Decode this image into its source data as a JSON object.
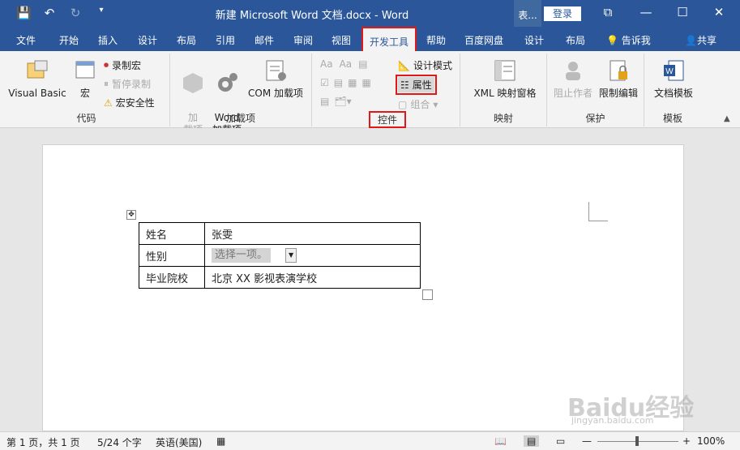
{
  "title_bar": {
    "title": "新建 Microsoft Word 文档.docx  -  Word",
    "mini_tab": "表...",
    "login": "登录"
  },
  "tabs": [
    "文件",
    "开始",
    "插入",
    "设计",
    "布局",
    "引用",
    "邮件",
    "审阅",
    "视图",
    "开发工具",
    "帮助",
    "百度网盘",
    "设计",
    "布局"
  ],
  "tell_me": "告诉我",
  "share": "共享",
  "groups": {
    "code": {
      "label": "代码",
      "visual_basic": "Visual Basic",
      "macro": "宏",
      "record": "录制宏",
      "pause": "暂停录制",
      "security": "宏安全性"
    },
    "addins": {
      "label": "加载项",
      "addin1": "加\n载项",
      "word_addin": "Word\n加载项",
      "com_addin": "COM 加载项"
    },
    "controls": {
      "label": "控件",
      "design_mode": "设计模式",
      "properties": "属性",
      "group": "组合"
    },
    "mapping": {
      "label": "映射",
      "xml_pane": "XML 映射窗格"
    },
    "protect": {
      "label": "保护",
      "block_authors": "阻止作者",
      "restrict": "限制编辑"
    },
    "templates": {
      "label": "模板",
      "doc_template": "文档模板"
    }
  },
  "table": {
    "rows": [
      [
        "姓名",
        "张雯"
      ],
      [
        "性别",
        "选择一项。"
      ],
      [
        "毕业院校",
        "北京 XX 影视表演学校"
      ]
    ]
  },
  "status": {
    "page": "第 1 页，共 1 页",
    "words": "5/24 个字",
    "lang": "英语(美国)",
    "zoom": "100%"
  },
  "watermark": {
    "logo": "Baidu经验",
    "url": "jingyan.baidu.com"
  }
}
